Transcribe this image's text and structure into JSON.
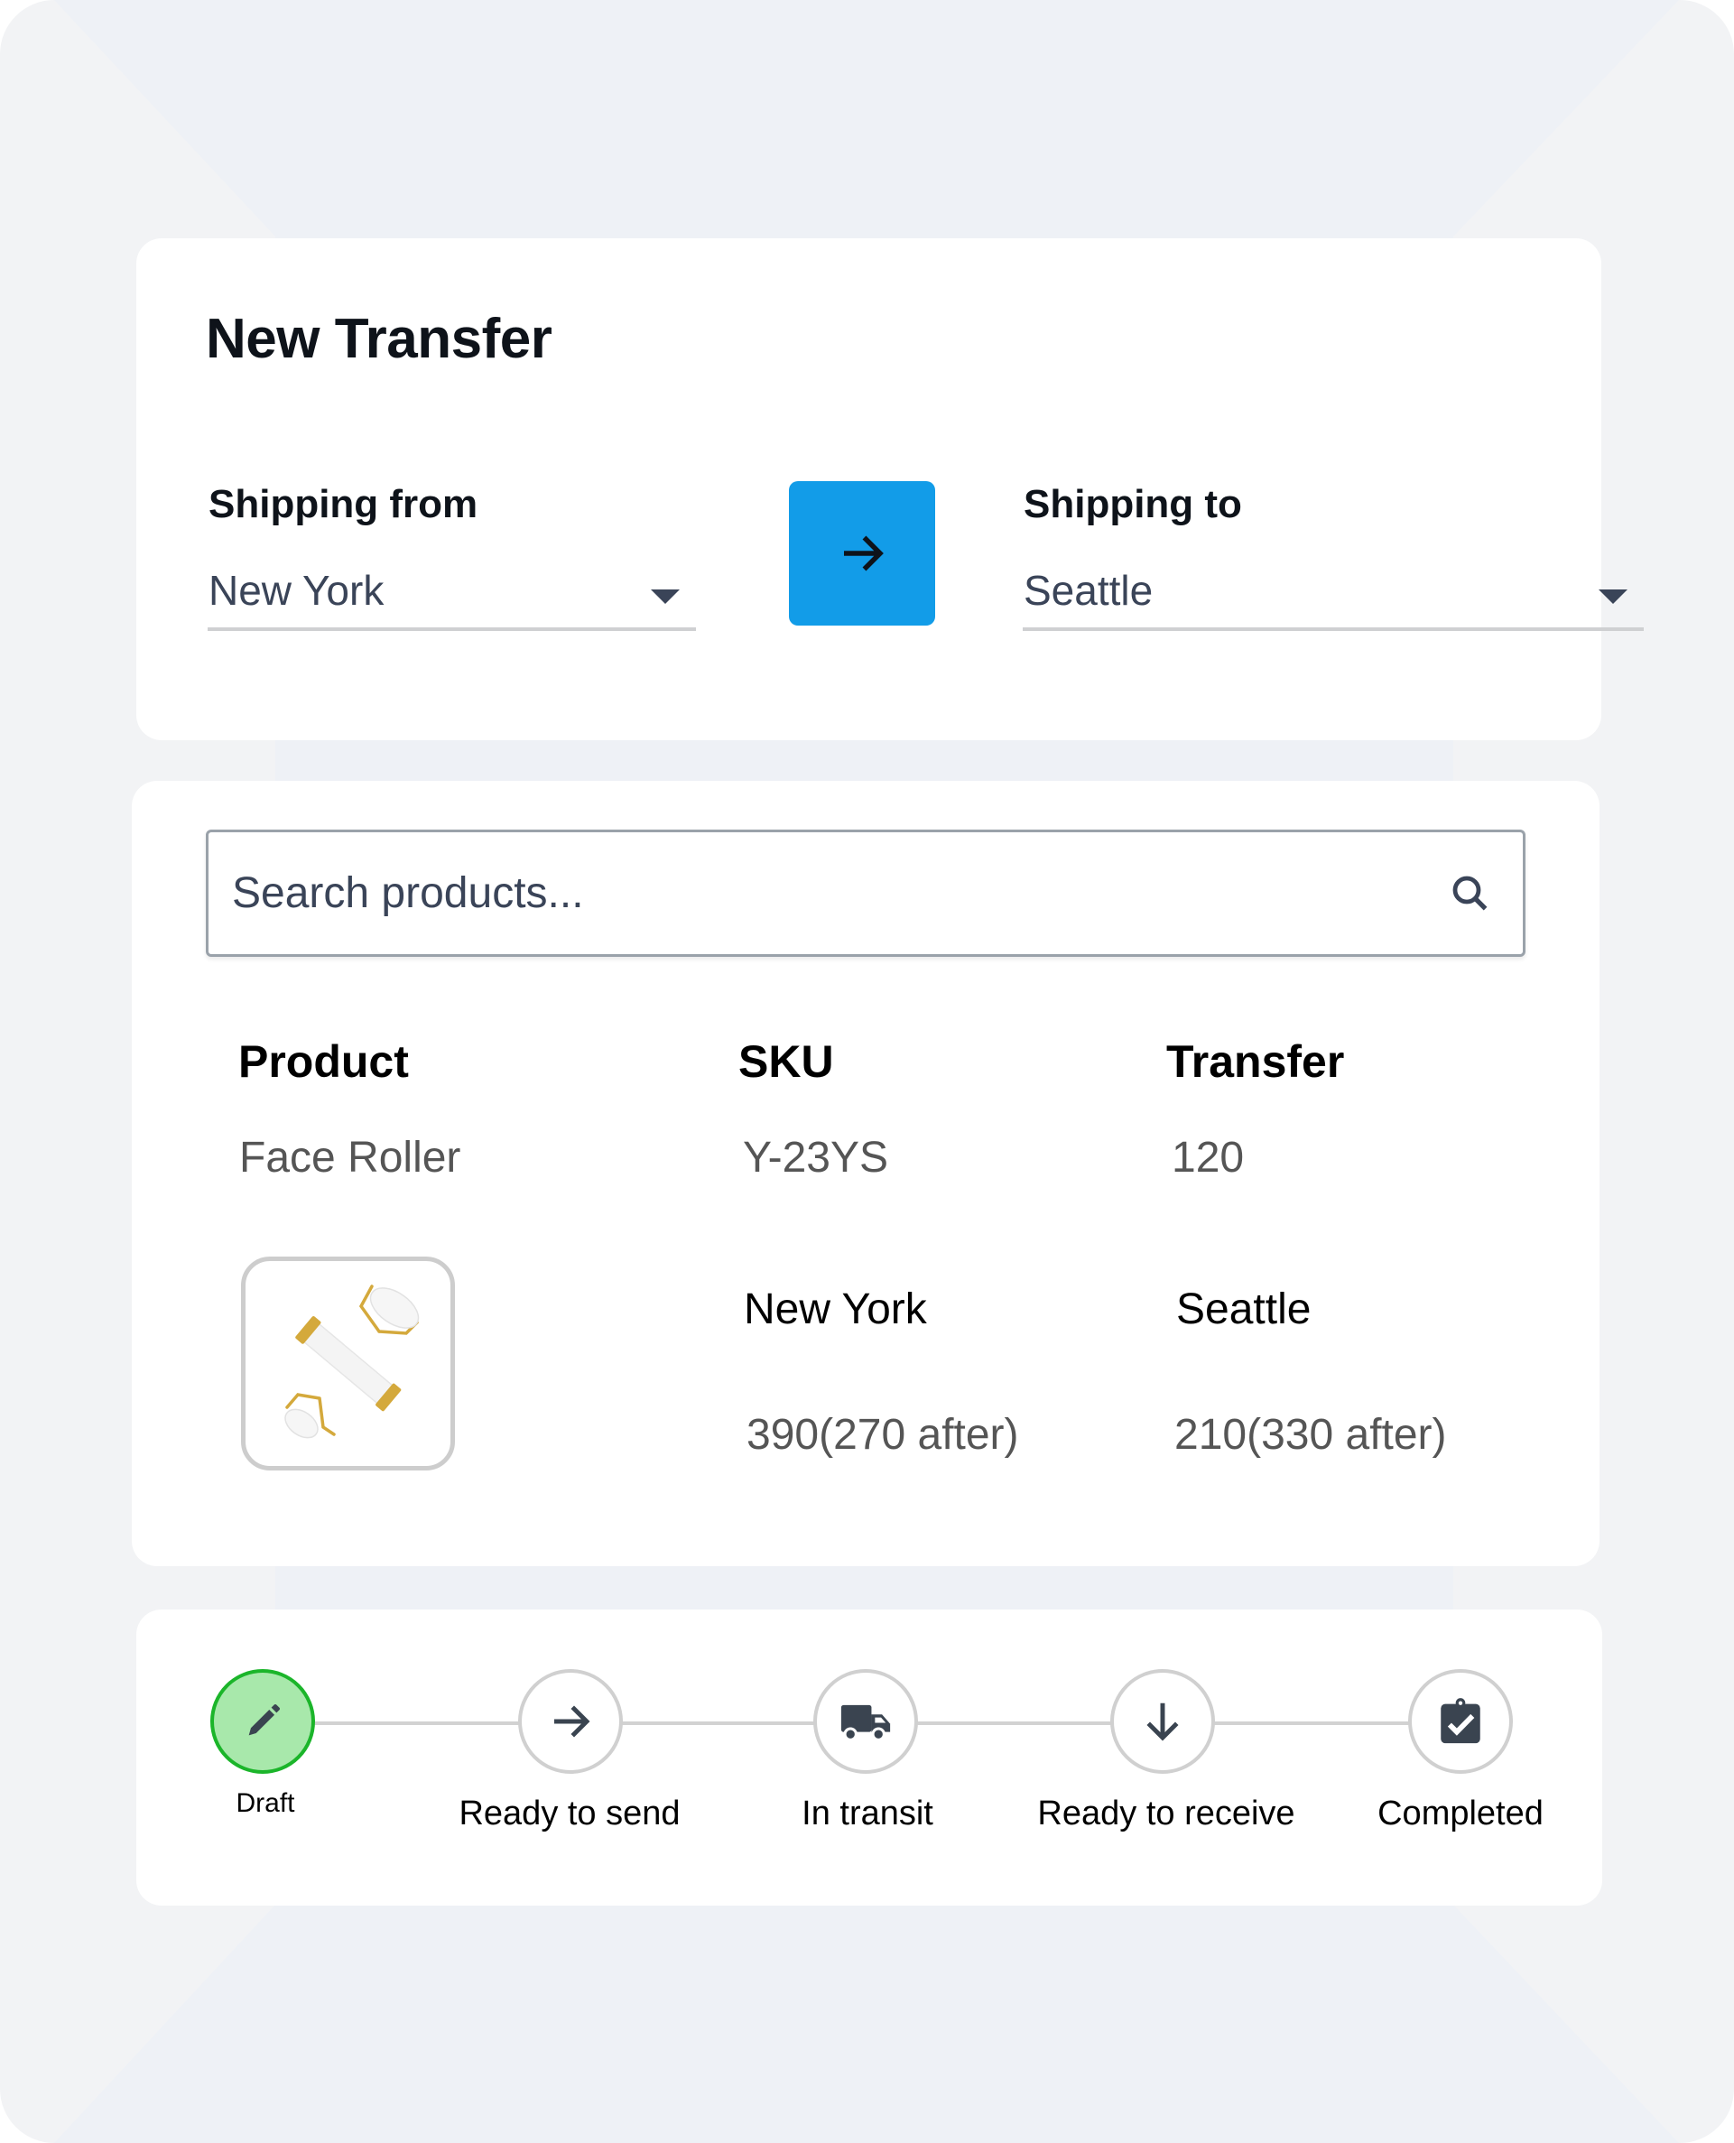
{
  "header": {
    "title": "New Transfer",
    "shipping_from": {
      "label": "Shipping from",
      "value": "New York"
    },
    "shipping_to": {
      "label": "Shipping to",
      "value": "Seattle"
    },
    "swap_icon": "arrow-right-icon",
    "accent_color": "#129ce8"
  },
  "products": {
    "search": {
      "placeholder": "Search products...",
      "value": "",
      "icon": "search-icon"
    },
    "columns": [
      "Product",
      "SKU",
      "Transfer"
    ],
    "rows": [
      {
        "product": "Face Roller",
        "sku": "Y-23YS",
        "transfer": "120",
        "image": "face-roller-image",
        "stock": {
          "from_location": "New York",
          "to_location": "Seattle",
          "from_value": "390(270 after)",
          "to_value": "210(330 after)"
        }
      }
    ]
  },
  "status": {
    "active_index": 0,
    "active_color": "#1bb52a",
    "steps": [
      {
        "label": "Draft",
        "icon": "pencil-icon"
      },
      {
        "label": "Ready to send",
        "icon": "arrow-right-icon"
      },
      {
        "label": "In transit",
        "icon": "truck-icon"
      },
      {
        "label": "Ready to receive",
        "icon": "arrow-down-icon"
      },
      {
        "label": "Completed",
        "icon": "clipboard-check-icon"
      }
    ]
  }
}
